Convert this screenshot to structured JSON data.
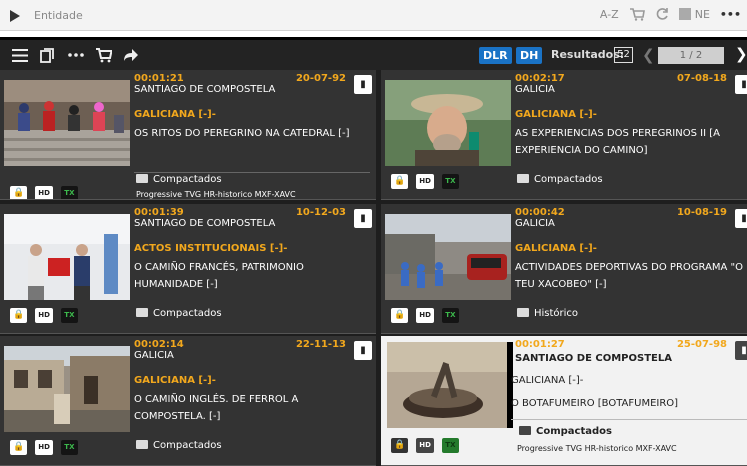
{
  "topbar": {
    "entity_label": "Entidade",
    "sort_label": "A-Z",
    "lang_label": "NE",
    "more_label": "•••"
  },
  "toolbar": {
    "dlr_label": "DLR",
    "dh_label": "DH",
    "results_label": "Resultados:",
    "results_count": "52",
    "page_label": "1 / 2"
  },
  "colors": {
    "accent_orange": "#f2a81d",
    "dark_bg": "#333333",
    "light_bg": "#f2f2f2",
    "badge_blue": "#1a73c6",
    "tx_green": "#3cb84c"
  },
  "cards": [
    {
      "time": "00:01:21",
      "date": "20-07-92",
      "place": "SANTIAGO DE COMPOSTELA",
      "category": "GALICIANA [-]-",
      "title": "OS RITOS DO PEREGRINO NA CATEDRAL [-]",
      "folder": "Compactados",
      "program": "Progressive TVG HR-historico MXF-XAVC",
      "chips": {
        "lock": "🔒",
        "hd": "HD",
        "tx": "TX"
      }
    },
    {
      "time": "00:02:17",
      "date": "07-08-18",
      "place": "GALICIA",
      "category": "GALICIANA [-]-",
      "title": "AS EXPERIENCIAS DOS PEREGRINOS II [A EXPERIENCIA DO CAMINO]",
      "folder": "Compactados",
      "program": "",
      "chips": {
        "lock": "🔒",
        "hd": "HD",
        "tx": "TX"
      }
    },
    {
      "time": "00:01:39",
      "date": "10-12-03",
      "place": "SANTIAGO DE COMPOSTELA",
      "category": "ACTOS INSTITUCIONAIS [-]-",
      "title": "O CAMIÑO FRANCÉS, PATRIMONIO HUMANIDADE [-]",
      "folder": "Compactados",
      "program": "",
      "chips": {
        "lock": "🔒",
        "hd": "HD",
        "tx": "TX"
      }
    },
    {
      "time": "00:00:42",
      "date": "10-08-19",
      "place": "GALICIA",
      "category": "GALICIANA [-]-",
      "title": "ACTIVIDADES DEPORTIVAS DO PROGRAMA \"O TEU XACOBEO\" [-]",
      "folder": "Histórico",
      "program": "",
      "chips": {
        "lock": "🔒",
        "hd": "HD",
        "tx": "TX"
      }
    },
    {
      "time": "00:02:14",
      "date": "22-11-13",
      "place": "GALICIA",
      "category": "GALICIANA [-]-",
      "title": "O CAMIÑO INGLÉS. DE FERROL A COMPOSTELA. [-]",
      "folder": "Compactados",
      "program": "",
      "chips": {
        "lock": "🔒",
        "hd": "HD",
        "tx": "TX"
      }
    },
    {
      "time": "00:01:27",
      "date": "25-07-98",
      "place": "SANTIAGO DE COMPOSTELA",
      "category": "GALICIANA [-]-",
      "title": "O BOTAFUMEIRO [BOTAFUMEIRO]",
      "folder": "Compactados",
      "program": "Progressive TVG HR-historico MXF-XAVC",
      "chips": {
        "lock": "🔒",
        "hd": "HD",
        "tx": "TX"
      }
    }
  ]
}
